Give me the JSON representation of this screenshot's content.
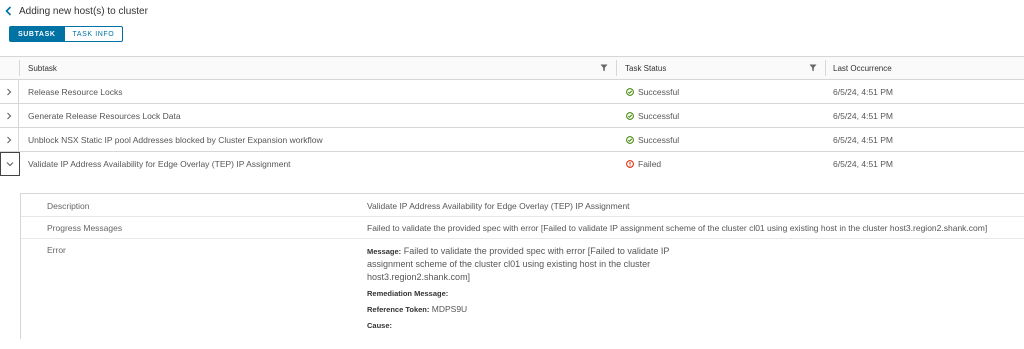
{
  "header": {
    "back_label": "Adding new host(s) to cluster"
  },
  "tabs": [
    {
      "label": "SUBTASK",
      "active": true
    },
    {
      "label": "TASK INFO",
      "active": false
    }
  ],
  "columns": {
    "subtask": "Subtask",
    "status": "Task Status",
    "last": "Last Occurrence"
  },
  "rows": [
    {
      "subtask": "Release Resource Locks",
      "status": "Successful",
      "time": "6/5/24, 4:51 PM"
    },
    {
      "subtask": "Generate Release Resources Lock Data",
      "status": "Successful",
      "time": "6/5/24, 4:51 PM"
    },
    {
      "subtask": "Unblock NSX Static IP pool Addresses blocked by Cluster Expansion workflow",
      "status": "Successful",
      "time": "6/5/24, 4:51 PM"
    },
    {
      "subtask": "Validate IP Address Availability for Edge Overlay (TEP) IP Assignment",
      "status": "Failed",
      "time": "6/5/24, 4:51 PM"
    }
  ],
  "detail": {
    "description_label": "Description",
    "description": "Validate IP Address Availability for Edge Overlay (TEP) IP Assignment",
    "progress_label": "Progress Messages",
    "progress": "Failed to validate the provided spec with error [Failed to validate IP assignment scheme of the cluster cl01 using existing host in the cluster host3.region2.shank.com]",
    "error_label": "Error",
    "error": {
      "message_key": "Message:",
      "message_lines": [
        "Failed to validate the provided spec with error [Failed to validate IP",
        "assignment scheme of the cluster cl01 using existing host in the cluster",
        "host3.region2.shank.com]"
      ],
      "remediation_key": "Remediation Message:",
      "token_key": "Reference Token:",
      "token": "MDPS9U",
      "cause_key": "Cause:"
    }
  },
  "colors": {
    "accent": "#0072a3",
    "success": "#3c8500",
    "error": "#e02200"
  },
  "icons": {
    "back": "chevron-left-icon",
    "filter": "filter-icon",
    "expand": "chevron-right-icon",
    "collapse": "chevron-down-icon",
    "success": "check-circle-icon",
    "failed": "error-circle-icon"
  }
}
